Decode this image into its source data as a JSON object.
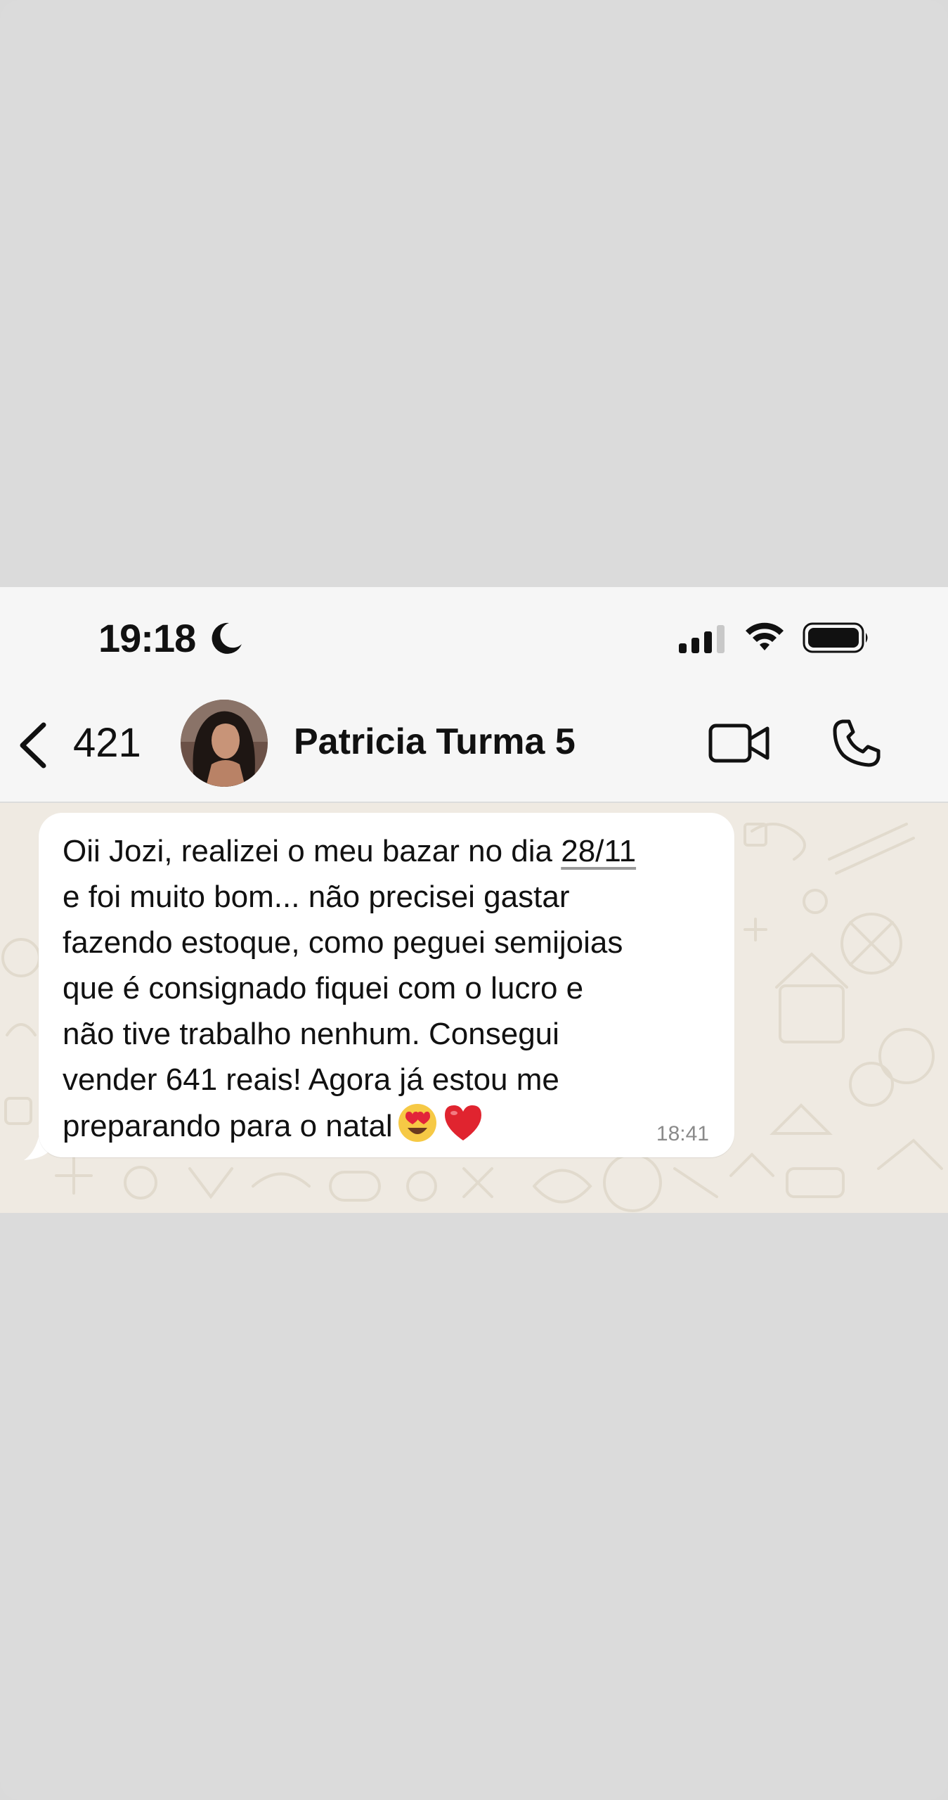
{
  "status_bar": {
    "time": "19:18",
    "icons": [
      "moon-icon",
      "cellular-signal-icon",
      "wifi-icon",
      "battery-icon"
    ]
  },
  "nav": {
    "back_count": "421",
    "contact_name": "Patricia Turma 5",
    "icons": [
      "chevron-left-icon",
      "video-call-icon",
      "phone-icon"
    ]
  },
  "message": {
    "text_before_date": "Oii Jozi, realizei o meu bazar no dia ",
    "date": "28/11",
    "text_after_date": "\ne foi muito bom... não precisei gastar\nfazendo estoque, como peguei semijoias\nque é consignado fiquei com o lucro e\nnão tive trabalho nenhum. Consegui\nvender 641 reais! Agora já estou me\npreparando para o natal",
    "emojis": [
      "smiling-face-with-heart-eyes-icon",
      "red-heart-icon"
    ],
    "time": "18:41"
  },
  "colors": {
    "chat_background": "#efeae2",
    "bubble": "#ffffff",
    "bars": "#f6f6f6",
    "outer_background": "#dbdbdb"
  }
}
